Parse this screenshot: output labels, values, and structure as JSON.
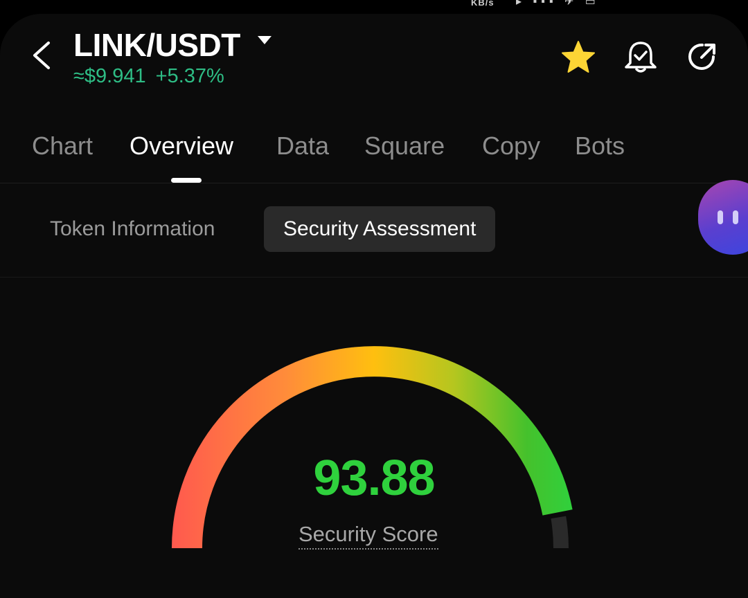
{
  "status_bar": {
    "network_speed": "KB/s"
  },
  "header": {
    "pair": "LINK/USDT",
    "price": "≈$9.941",
    "change": "+5.37%",
    "colors": {
      "positive": "#2ebd85",
      "favorite": "#fcd535"
    },
    "icons": [
      "back-arrow-icon",
      "caret-down-icon",
      "star-icon",
      "alarm-bell-icon",
      "share-icon"
    ]
  },
  "tabs": [
    {
      "label": "Chart"
    },
    {
      "label": "Overview"
    },
    {
      "label": "Data"
    },
    {
      "label": "Square"
    },
    {
      "label": "Copy"
    },
    {
      "label": "Bots"
    }
  ],
  "active_tab": "Overview",
  "subtabs": [
    {
      "label": "Token Information"
    },
    {
      "label": "Security Assessment"
    }
  ],
  "active_subtab": "Security Assessment",
  "security": {
    "score": "93.88",
    "score_value": 93.88,
    "label": "Security Score",
    "score_color": "#2fd13d"
  }
}
